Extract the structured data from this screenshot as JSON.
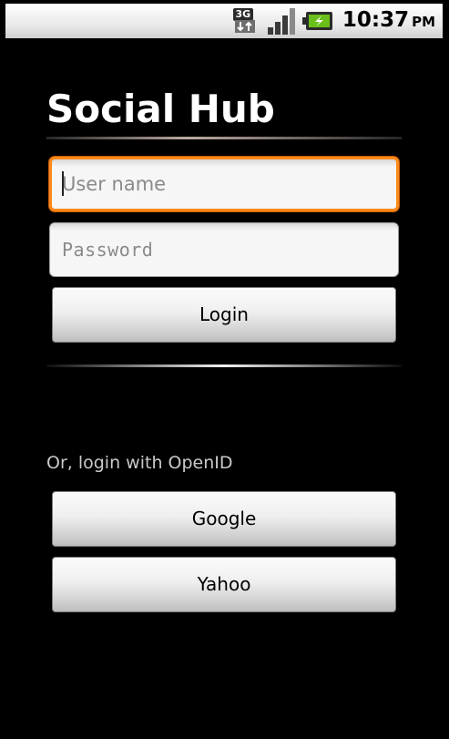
{
  "status_bar": {
    "network_type": "3G",
    "time": "10:37",
    "ampm": "PM",
    "icons": [
      "network-3g-icon",
      "signal-strength-icon",
      "battery-charging-icon"
    ]
  },
  "app": {
    "title": "Social Hub"
  },
  "login_form": {
    "username_placeholder": "User name",
    "username_value": "",
    "password_placeholder": "Password",
    "password_value": "",
    "login_button_label": "Login"
  },
  "openid": {
    "label": "Or, login with OpenID",
    "providers": [
      {
        "label": "Google"
      },
      {
        "label": "Yahoo"
      }
    ]
  },
  "colors": {
    "background": "#000000",
    "focus_border": "#ff8a1c",
    "battery_charge": "#6bbf1a"
  }
}
